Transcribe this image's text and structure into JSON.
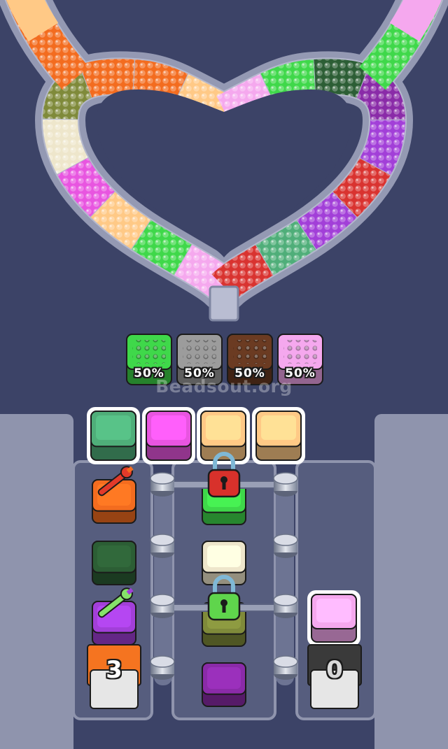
{
  "app": {
    "watermark": "Beadsout.org"
  },
  "colors": {
    "background": "#3c4367",
    "track": "#8b91ac",
    "green": "#3fd84a",
    "gray": "#9c9c9c",
    "brown": "#6b3b22",
    "pink": "#f5a8ee",
    "sea_green": "#4fae79",
    "magenta": "#e855e0",
    "peach": "#ffc986",
    "orange": "#f36c1f",
    "dark_green": "#2c5e35",
    "violet": "#a23fd8",
    "cream": "#eee6cb",
    "olive": "#7f8a3a",
    "purple": "#8a2ba8",
    "red": "#d93330"
  },
  "track": {
    "shape": "heart",
    "bead_segments": [
      "peach",
      "orange",
      "orange",
      "olive",
      "cream",
      "magenta",
      "peach",
      "green",
      "pink",
      "red",
      "sea_green",
      "violet",
      "red",
      "violet",
      "purple",
      "dark_green",
      "green",
      "pink"
    ]
  },
  "collectors": [
    {
      "color": "green",
      "label": "50%"
    },
    {
      "color": "gray",
      "label": "50%"
    },
    {
      "color": "brown",
      "label": "50%"
    },
    {
      "color": "pink",
      "label": "50%"
    }
  ],
  "holding_slots": [
    {
      "color": "sea_green"
    },
    {
      "color": "magenta"
    },
    {
      "color": "peach"
    },
    {
      "color": "peach"
    }
  ],
  "board": {
    "left_column": [
      {
        "color": "orange",
        "tool": "wrench-icon"
      },
      {
        "color": "dark_green"
      },
      {
        "color": "violet",
        "tool": "wrench-icon"
      }
    ],
    "middle_column": [
      {
        "color": "green",
        "locked": true,
        "lock_color": "red"
      },
      {
        "color": "cream"
      },
      {
        "color": "olive",
        "locked": true,
        "lock_color": "green"
      },
      {
        "color": "purple"
      }
    ],
    "right_column": [
      {
        "color": "pink"
      }
    ],
    "left_spawner": {
      "count": "3",
      "color": "orange"
    },
    "right_spawner": {
      "count": "0",
      "color": "gray"
    }
  }
}
